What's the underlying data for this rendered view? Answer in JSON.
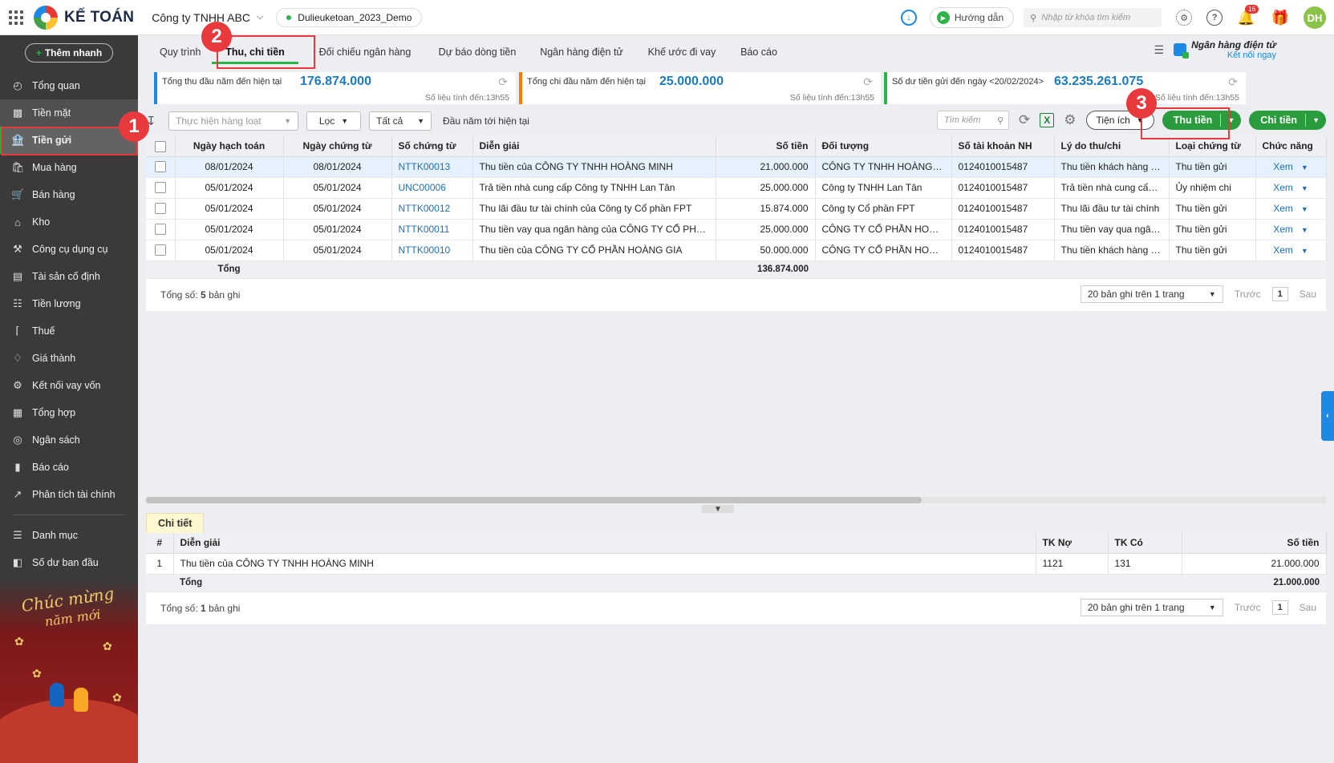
{
  "header": {
    "logo_text": "KẾ TOÁN",
    "company": "Công ty TNHH ABC",
    "database": "Dulieuketoan_2023_Demo",
    "guide_label": "Hướng dẫn",
    "search_placeholder": "Nhập từ khóa tìm kiếm",
    "notification_count": "16",
    "avatar_initials": "DH"
  },
  "sidebar": {
    "quick_add": "Thêm nhanh",
    "items": [
      {
        "label": "Tổng quan",
        "icon": "gauge-icon"
      },
      {
        "label": "Tiền mặt",
        "icon": "cash-icon"
      },
      {
        "label": "Tiền gửi",
        "icon": "bank-icon"
      },
      {
        "label": "Mua hàng",
        "icon": "bag-icon"
      },
      {
        "label": "Bán hàng",
        "icon": "cart-icon"
      },
      {
        "label": "Kho",
        "icon": "warehouse-icon"
      },
      {
        "label": "Công cụ dụng cụ",
        "icon": "tools-icon"
      },
      {
        "label": "Tài sản cố định",
        "icon": "asset-icon"
      },
      {
        "label": "Tiền lương",
        "icon": "payroll-icon"
      },
      {
        "label": "Thuế",
        "icon": "tax-icon"
      },
      {
        "label": "Giá thành",
        "icon": "tag-icon"
      },
      {
        "label": "Kết nối vay vốn",
        "icon": "loan-icon"
      },
      {
        "label": "Tổng hợp",
        "icon": "ledger-icon"
      },
      {
        "label": "Ngân sách",
        "icon": "budget-icon"
      },
      {
        "label": "Báo cáo",
        "icon": "bar-chart-icon"
      },
      {
        "label": "Phân tích tài chính",
        "icon": "line-chart-icon"
      }
    ],
    "bottom_items": [
      {
        "label": "Danh mục",
        "icon": "list-icon"
      },
      {
        "label": "Số dư ban đầu",
        "icon": "balance-icon"
      }
    ],
    "greeting_line1": "Chúc mừng",
    "greeting_line2": "năm mới"
  },
  "tabs": [
    "Quy trình",
    "Thu, chi tiền",
    "Đối chiếu ngân hàng",
    "Dự báo dòng tiền",
    "Ngân hàng điện tử",
    "Khế ước đi vay",
    "Báo cáo"
  ],
  "ebank": {
    "title": "Ngân hàng điện tử",
    "link": "Kết nối ngay"
  },
  "summary": [
    {
      "label": "Tổng thu đầu năm đến hiện tại",
      "value": "176.874.000",
      "asof": "Số liệu tính đến:13h55",
      "accent": "#1e88e5"
    },
    {
      "label": "Tổng chi đầu năm đến hiện tại",
      "value": "25.000.000",
      "asof": "Số liệu tính đến:13h55",
      "accent": "#f57c00"
    },
    {
      "label": "Số dư tiền gửi đến ngày <20/02/2024>",
      "value": "63.235.261.075",
      "asof": "Số liệu tính đến:13h55",
      "accent": "#2db34a"
    }
  ],
  "toolbar": {
    "batch": "Thực hiện hàng loạt",
    "filter": "Lọc",
    "all": "Tất cả",
    "period": "Đầu năm tới hiện tại",
    "search_placeholder": "Tìm kiếm",
    "utilities": "Tiện ích",
    "receive": "Thu tiền",
    "pay": "Chi tiền"
  },
  "table": {
    "columns": [
      "Ngày hạch toán",
      "Ngày chứng từ",
      "Số chứng từ",
      "Diễn giải",
      "Số tiền",
      "Đối tượng",
      "Số tài khoản NH",
      "Lý do thu/chi",
      "Loại chứng từ",
      "Chức năng"
    ],
    "rows": [
      {
        "post_date": "08/01/2024",
        "doc_date": "08/01/2024",
        "doc_no": "NTTK00013",
        "desc": "Thu tiền của CÔNG TY TNHH HOÀNG MINH",
        "amount": "21.000.000",
        "party": "CÔNG TY TNHH HOÀNG MINH",
        "account": "0124010015487",
        "reason": "Thu tiền khách hàng (không theo hóa đơn)",
        "type": "Thu tiền gửi",
        "action": "Xem"
      },
      {
        "post_date": "05/01/2024",
        "doc_date": "05/01/2024",
        "doc_no": "UNC00006",
        "desc": "Trả tiền nhà cung cấp Công ty TNHH Lan Tân",
        "amount": "25.000.000",
        "party": "Công ty TNHH Lan Tân",
        "account": "0124010015487",
        "reason": "Trả tiền nhà cung cấp (không theo hóa đơn)",
        "type": "Ủy nhiệm chi",
        "action": "Xem"
      },
      {
        "post_date": "05/01/2024",
        "doc_date": "05/01/2024",
        "doc_no": "NTTK00012",
        "desc": "Thu lãi đầu tư tài chính của Công ty Cổ phần FPT",
        "amount": "15.874.000",
        "party": "Công ty Cổ phần FPT",
        "account": "0124010015487",
        "reason": "Thu lãi đầu tư tài chính",
        "type": "Thu tiền gửi",
        "action": "Xem"
      },
      {
        "post_date": "05/01/2024",
        "doc_date": "05/01/2024",
        "doc_no": "NTTK00011",
        "desc": "Thu tiền vay qua ngân hàng của CÔNG TY CỔ PHẦN HOÀNG GIA",
        "amount": "25.000.000",
        "party": "CÔNG TY CỔ PHẦN HOÀNG GIA",
        "account": "0124010015487",
        "reason": "Thu tiền vay qua ngân hàng",
        "type": "Thu tiền gửi",
        "action": "Xem"
      },
      {
        "post_date": "05/01/2024",
        "doc_date": "05/01/2024",
        "doc_no": "NTTK00010",
        "desc": "Thu tiền của CÔNG TY CỔ PHẦN HOÀNG GIA",
        "amount": "50.000.000",
        "party": "CÔNG TY CỔ PHẦN HOÀNG GIA",
        "account": "0124010015487",
        "reason": "Thu tiền khách hàng (không theo hóa đơn)",
        "type": "Thu tiền gửi",
        "action": "Xem"
      }
    ],
    "total_label": "Tổng",
    "total_amount": "136.874.000",
    "count_prefix": "Tổng số:",
    "count": "5",
    "count_suffix": "bản ghi"
  },
  "pager": {
    "page_size": "20 bản ghi trên 1 trang",
    "prev": "Trước",
    "page": "1",
    "next": "Sau"
  },
  "detail": {
    "tab": "Chi tiết",
    "columns": [
      "#",
      "Diễn giải",
      "TK Nợ",
      "TK Có",
      "Số tiền"
    ],
    "rows": [
      {
        "idx": "1",
        "desc": "Thu tiền của CÔNG TY TNHH HOÀNG MINH",
        "debit": "1121",
        "credit": "131",
        "amount": "21.000.000"
      }
    ],
    "total_label": "Tổng",
    "total_amount": "21.000.000",
    "count_prefix": "Tổng số:",
    "count": "1",
    "count_suffix": "bản ghi"
  },
  "annotations": [
    "1",
    "2",
    "3"
  ],
  "colors": {
    "accent_green": "#2a9c3d",
    "sidebar_bg": "#3a3a3a",
    "highlight_red": "#e8393d",
    "link_blue": "#1e6fb8"
  }
}
